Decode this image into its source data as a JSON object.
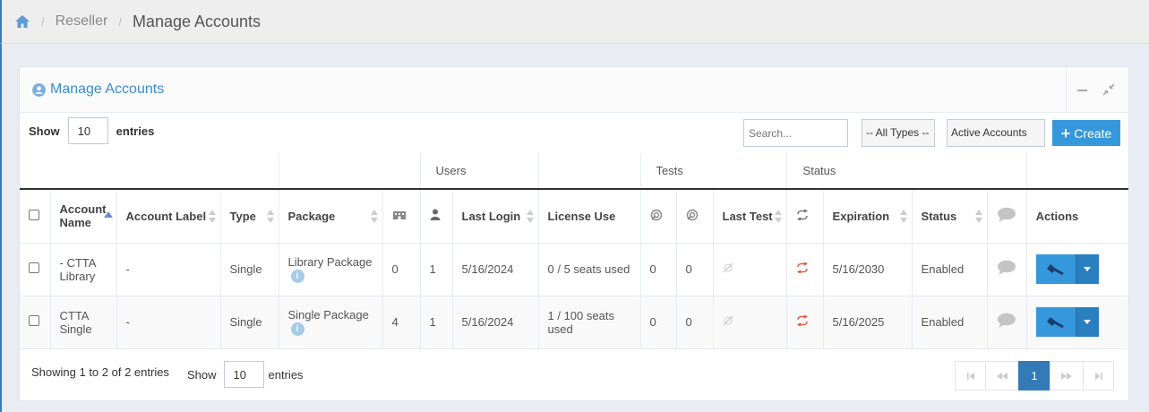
{
  "breadcrumb": {
    "items": [
      "Reseller",
      "Manage Accounts"
    ]
  },
  "portlet": {
    "title": "Manage Accounts"
  },
  "controls": {
    "show_label": "Show",
    "entries_label": "entries",
    "page_size": "10",
    "search_placeholder": "Search...",
    "type_filter": "-- All Types --",
    "account_filter": "Active Accounts",
    "create_label": "Create"
  },
  "table": {
    "groups": {
      "users": "Users",
      "tests": "Tests",
      "status": "Status"
    },
    "columns": {
      "account_name": "Account Name",
      "account_label": "Account Label",
      "type": "Type",
      "package": "Package",
      "last_login": "Last Login",
      "license_use": "License Use",
      "last_test": "Last Test",
      "expiration": "Expiration",
      "status": "Status",
      "actions": "Actions"
    },
    "rows": [
      {
        "account_name": "- CTTA Library",
        "account_label": "-",
        "type": "Single",
        "package": "Library Package",
        "count": "0",
        "users": "1",
        "last_login": "5/16/2024",
        "license_use": "0 / 5 seats used",
        "test1": "0",
        "test2": "0",
        "expiration": "5/16/2030",
        "status": "Enabled"
      },
      {
        "account_name": "CTTA Single",
        "account_label": "-",
        "type": "Single",
        "package": "Single Package",
        "count": "4",
        "users": "1",
        "last_login": "5/16/2024",
        "license_use": "1 / 100 seats used",
        "test1": "0",
        "test2": "0",
        "expiration": "5/16/2025",
        "status": "Enabled"
      }
    ]
  },
  "footer": {
    "info": "Showing 1 to 2 of 2 entries",
    "show_label": "Show",
    "page_size": "10",
    "entries_label": "entries",
    "current_page": "1"
  },
  "colors": {
    "accent": "#3598dc",
    "page_active": "#337ab7",
    "title": "#3b8bcf"
  }
}
